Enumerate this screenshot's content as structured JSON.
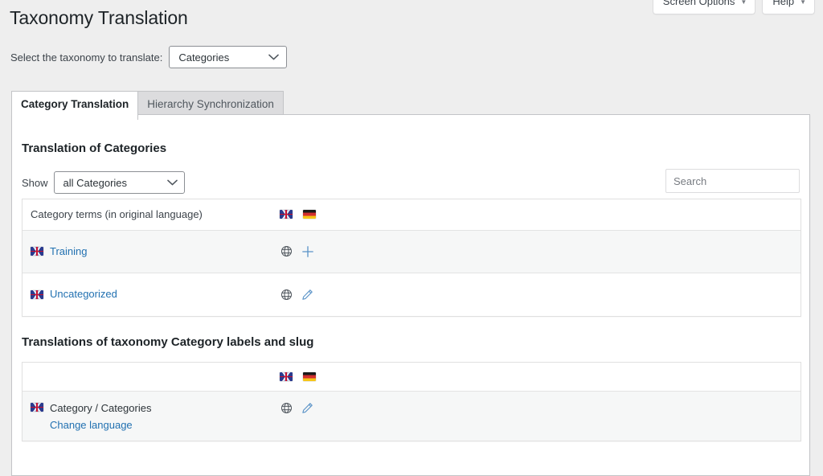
{
  "meta_buttons": [
    {
      "label": "Screen Options",
      "icon": "caret-down-icon"
    },
    {
      "label": "Help",
      "icon": "caret-down-icon"
    }
  ],
  "page_title": "Taxonomy Translation",
  "taxonomy_selector": {
    "label": "Select the taxonomy to translate:",
    "value": "Categories"
  },
  "tabs": [
    {
      "label": "Category Translation",
      "active": true
    },
    {
      "label": "Hierarchy Synchronization",
      "active": false
    }
  ],
  "translation_section": {
    "heading": "Translation of Categories",
    "show_label": "Show",
    "show_value": "all Categories",
    "search_placeholder": "Search",
    "table": {
      "header": {
        "label": "Category terms (in original language)",
        "flags": [
          "gb",
          "de"
        ]
      },
      "rows": [
        {
          "flag": "gb",
          "label": "Training",
          "is_link": true,
          "actions": [
            "globe-icon",
            "add-icon"
          ]
        },
        {
          "flag": "gb",
          "label": "Uncategorized",
          "is_link": true,
          "actions": [
            "globe-icon",
            "edit-icon"
          ]
        }
      ]
    }
  },
  "labels_section": {
    "heading": "Translations of taxonomy Category labels and slug",
    "table": {
      "header": {
        "label": "",
        "flags": [
          "gb",
          "de"
        ]
      },
      "rows": [
        {
          "flag": "gb",
          "label": "Category / Categories",
          "is_link": false,
          "sub_link": "Change language",
          "actions": [
            "globe-icon",
            "edit-icon"
          ]
        }
      ]
    }
  },
  "colors": {
    "link": "#2271b1",
    "icon_blue": "#5a93c7",
    "background": "#eeeeee",
    "panel": "#ffffff"
  }
}
